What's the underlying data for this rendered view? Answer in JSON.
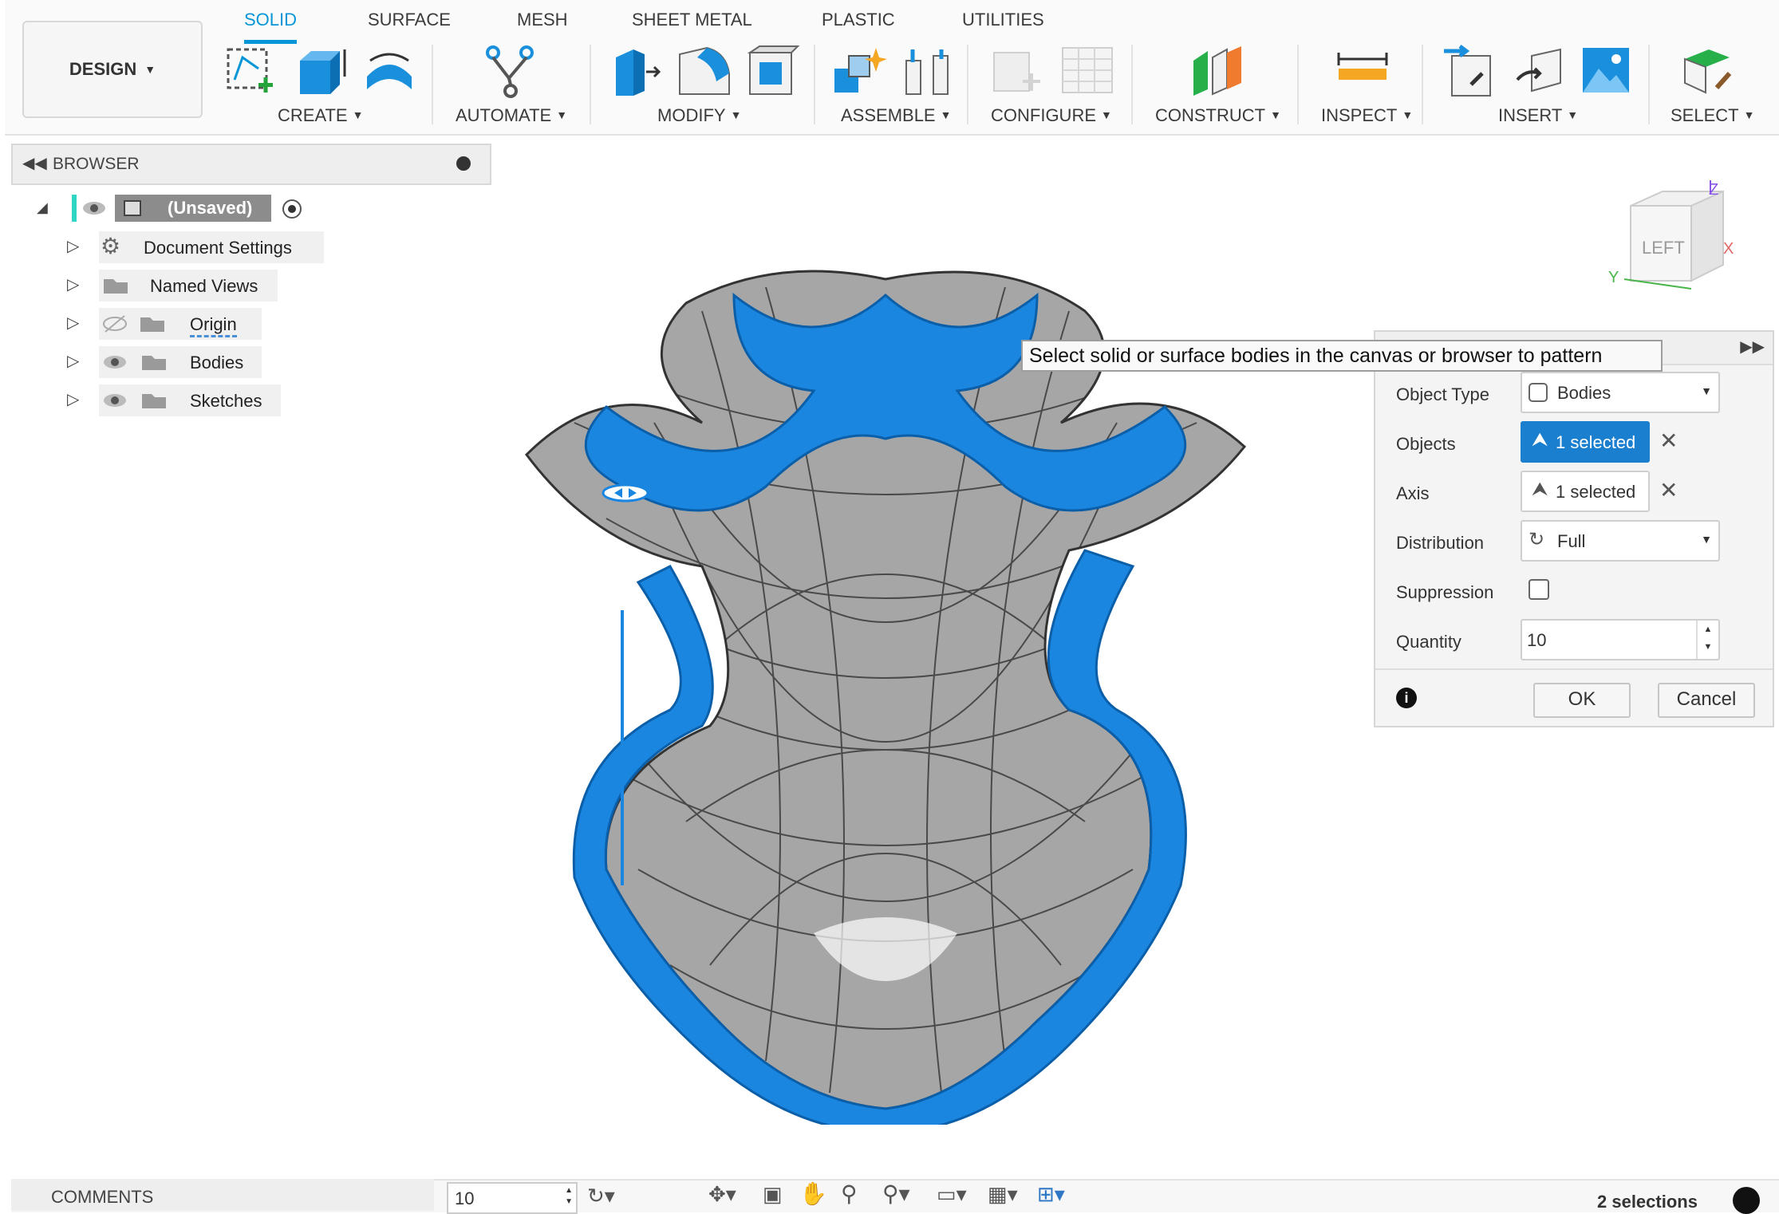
{
  "design_menu": {
    "label": "DESIGN"
  },
  "tabs": [
    "SOLID",
    "SURFACE",
    "MESH",
    "SHEET METAL",
    "PLASTIC",
    "UTILITIES"
  ],
  "groups": [
    "CREATE",
    "AUTOMATE",
    "MODIFY",
    "ASSEMBLE",
    "CONFIGURE",
    "CONSTRUCT",
    "INSPECT",
    "INSERT",
    "SELECT"
  ],
  "browser": {
    "title": "BROWSER",
    "root": "(Unsaved)",
    "items": [
      "Document Settings",
      "Named Views",
      "Origin",
      "Bodies",
      "Sketches"
    ]
  },
  "tooltip": "Select solid or surface bodies in the canvas or browser to pattern",
  "view_cube": {
    "face": "LEFT",
    "axes": {
      "z": "Z",
      "x": "X",
      "y": "Y"
    }
  },
  "dialog": {
    "object_type": {
      "label": "Object Type",
      "value": "Bodies"
    },
    "objects": {
      "label": "Objects",
      "value": "1 selected"
    },
    "axis": {
      "label": "Axis",
      "value": "1 selected"
    },
    "distribution": {
      "label": "Distribution",
      "value": "Full"
    },
    "suppression": {
      "label": "Suppression"
    },
    "quantity": {
      "label": "Quantity",
      "value": "10"
    },
    "ok": "OK",
    "cancel": "Cancel"
  },
  "bottom_bar": {
    "comments": "COMMENTS",
    "quantity_value": "10",
    "status": "2 selections"
  },
  "colors": {
    "accent": "#0696d7",
    "selection_blue": "#1b7fd0",
    "body_gray": "#a8a8a8"
  }
}
